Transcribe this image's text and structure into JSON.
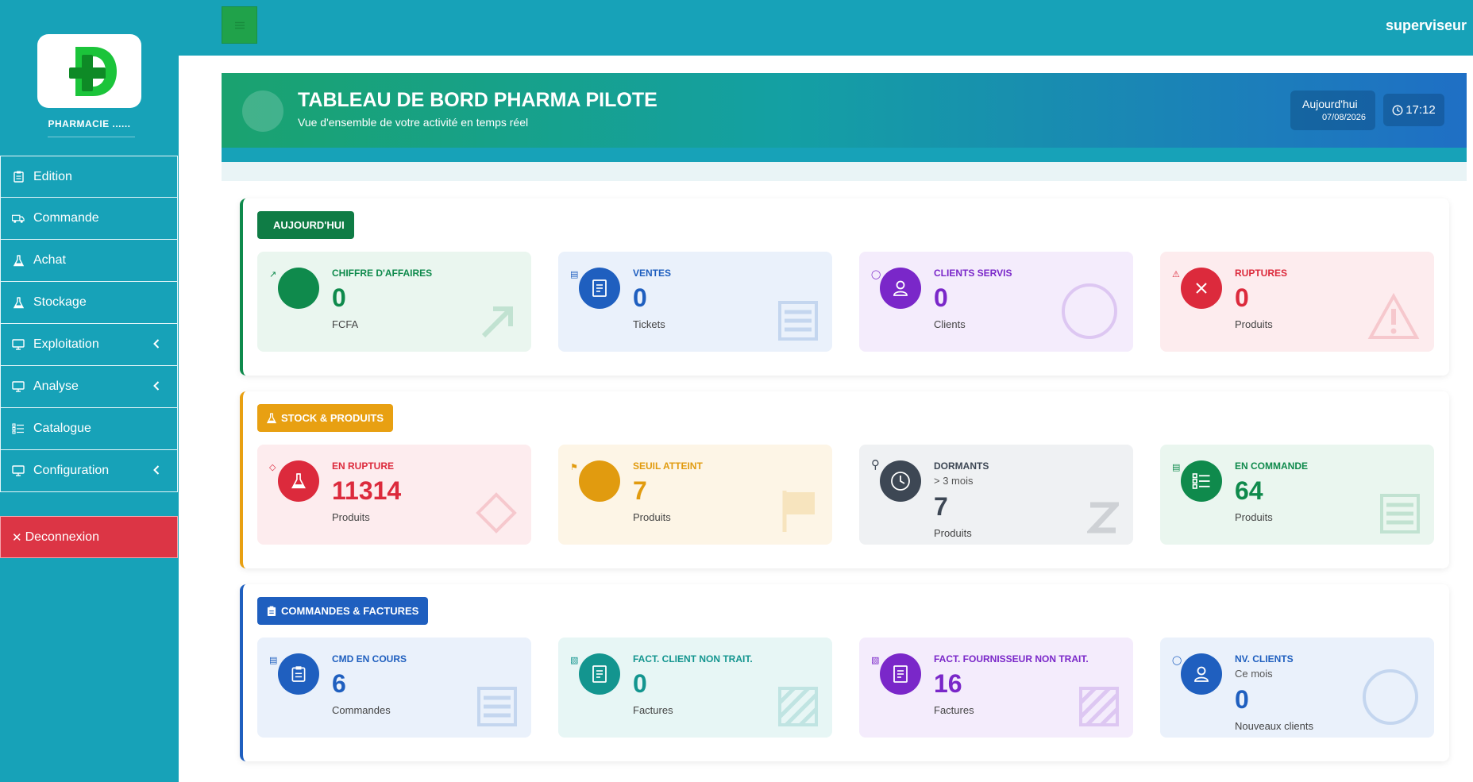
{
  "sidebar": {
    "logo_text": "PHARMACIE ......",
    "items": [
      {
        "label": "Edition",
        "icon": "clipboard-icon",
        "has_chevron": false
      },
      {
        "label": "Commande",
        "icon": "truck-icon",
        "has_chevron": false
      },
      {
        "label": "Achat",
        "icon": "flask-icon",
        "has_chevron": false
      },
      {
        "label": "Stockage",
        "icon": "flask-icon",
        "has_chevron": false
      },
      {
        "label": "Exploitation",
        "icon": "monitor-icon",
        "has_chevron": true
      },
      {
        "label": "Analyse",
        "icon": "monitor-icon",
        "has_chevron": true
      },
      {
        "label": "Catalogue",
        "icon": "list-icon",
        "has_chevron": false
      },
      {
        "label": "Configuration",
        "icon": "monitor-icon",
        "has_chevron": true
      }
    ],
    "logout_label": "Deconnexion"
  },
  "topbar": {
    "user": "superviseur"
  },
  "hero": {
    "title": "TABLEAU DE BORD PHARMA PILOTE",
    "subtitle": "Vue d'ensemble de votre activité en temps réel",
    "date_label": "Aujourd'hui",
    "date_value": "07/08/2026",
    "time_value": "17:12"
  },
  "sections": [
    {
      "label": "AUJOURD'HUI",
      "color": "#0f8a4c",
      "cards": [
        {
          "title": "CHIFFRE D'AFFAIRES",
          "value": "0",
          "unit": "FCFA",
          "sub": "",
          "color": "#0f8a4c",
          "bg": "#eaf6ef",
          "icon": "trend-up-icon"
        },
        {
          "title": "VENTES",
          "value": "0",
          "unit": "Tickets",
          "sub": "",
          "color": "#1f5fbf",
          "bg": "#eaf1fb",
          "icon": "receipt-icon"
        },
        {
          "title": "CLIENTS SERVIS",
          "value": "0",
          "unit": "Clients",
          "sub": "",
          "color": "#7a27c9",
          "bg": "#f4ecfc",
          "icon": "user-icon"
        },
        {
          "title": "RUPTURES",
          "value": "0",
          "unit": "Produits",
          "sub": "",
          "color": "#dc2a3c",
          "bg": "#fdecee",
          "icon": "close-icon"
        }
      ]
    },
    {
      "label": "STOCK & PRODUITS",
      "color": "#e8a012",
      "cards": [
        {
          "title": "EN RUPTURE",
          "value": "11314",
          "unit": "Produits",
          "sub": "",
          "color": "#dc2a3c",
          "bg": "#fdecee",
          "icon": "flask-icon"
        },
        {
          "title": "SEUIL ATTEINT",
          "value": "7",
          "unit": "Produits",
          "sub": "",
          "color": "#e19b0f",
          "bg": "#fdf5e6",
          "icon": "flag-icon"
        },
        {
          "title": "DORMANTS",
          "value": "7",
          "unit": "Produits",
          "sub": "> 3 mois",
          "color": "#3d4754",
          "bg": "#eff1f3",
          "icon": "clock-icon"
        },
        {
          "title": "EN COMMANDE",
          "value": "64",
          "unit": "Produits",
          "sub": "",
          "color": "#0f8a4c",
          "bg": "#eaf6ef",
          "icon": "list-icon"
        }
      ]
    },
    {
      "label": "COMMANDES & FACTURES",
      "color": "#1f5fbf",
      "cards": [
        {
          "title": "CMD EN COURS",
          "value": "6",
          "unit": "Commandes",
          "sub": "",
          "color": "#1f5fbf",
          "bg": "#eaf1fb",
          "icon": "clipboard-icon"
        },
        {
          "title": "FACT. CLIENT NON TRAIT.",
          "value": "0",
          "unit": "Factures",
          "sub": "",
          "color": "#13958f",
          "bg": "#e7f6f5",
          "icon": "receipt-icon"
        },
        {
          "title": "FACT. FOURNISSEUR NON TRAIT.",
          "value": "16",
          "unit": "Factures",
          "sub": "",
          "color": "#7a27c9",
          "bg": "#f4ecfc",
          "icon": "receipt-icon"
        },
        {
          "title": "NV. CLIENTS",
          "value": "0",
          "unit": "Nouveaux clients",
          "sub": "Ce mois",
          "color": "#1f5fbf",
          "bg": "#eaf1fb",
          "icon": "user-icon"
        }
      ]
    }
  ]
}
